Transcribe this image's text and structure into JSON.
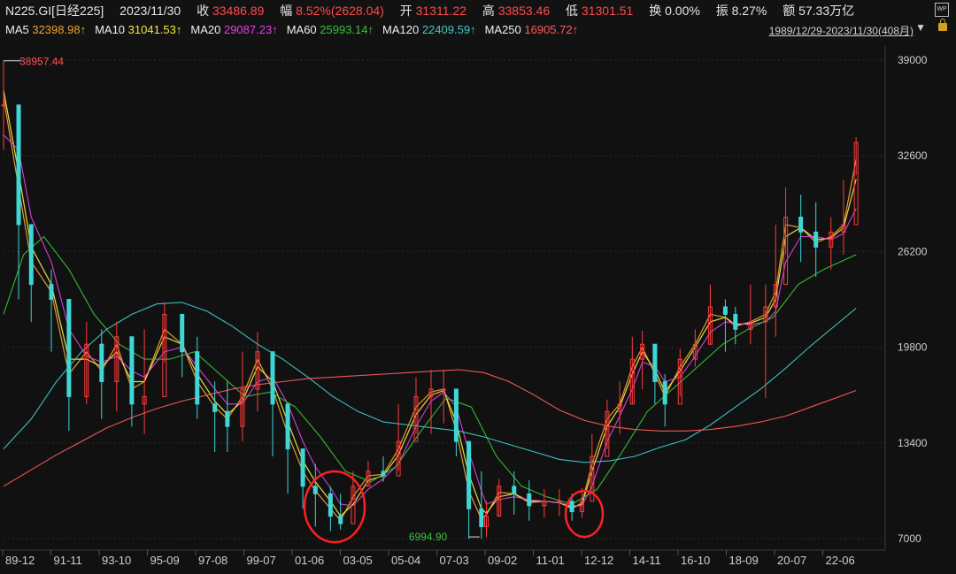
{
  "header": {
    "symbol": "N225.GI[日经225]",
    "date": "2023/11/30",
    "close_label": "收",
    "close_value": "33486.89",
    "change_label": "幅",
    "change_value": "8.52%(2628.04)",
    "open_label": "开",
    "open_value": "31311.22",
    "high_label": "高",
    "high_value": "33853.46",
    "low_label": "低",
    "low_value": "31301.51",
    "turnover_label": "换",
    "turnover_value": "0.00%",
    "amplitude_label": "振",
    "amplitude_value": "8.27%",
    "amount_label": "额",
    "amount_value": "57.33万亿",
    "range": "1989/12/29-2023/11/30(408月)",
    "wp_label": "WP",
    "ma": [
      {
        "name": "MA5",
        "value": "32398.98↑",
        "color": "#f0f0f0",
        "value_color": "#f0a030"
      },
      {
        "name": "MA10",
        "value": "31041.53↑",
        "color": "#f0f0f0",
        "value_color": "#f5e642"
      },
      {
        "name": "MA20",
        "value": "29087.23↑",
        "color": "#f0f0f0",
        "value_color": "#e040e0"
      },
      {
        "name": "MA60",
        "value": "25993.14↑",
        "color": "#f0f0f0",
        "value_color": "#36c236"
      },
      {
        "name": "MA120",
        "value": "22409.59↑",
        "color": "#f0f0f0",
        "value_color": "#40c8c8"
      },
      {
        "name": "MA250",
        "value": "16905.72↑",
        "color": "#f0f0f0",
        "value_color": "#ff5a5a"
      }
    ]
  },
  "chart_data": {
    "type": "line",
    "x_tick_labels": [
      "89-12",
      "91-11",
      "93-10",
      "95-09",
      "97-08",
      "99-07",
      "01-06",
      "03-05",
      "05-04",
      "07-03",
      "09-02",
      "11-01",
      "12-12",
      "14-11",
      "16-10",
      "18-09",
      "20-07",
      "22-06"
    ],
    "y_ticks": [
      7000,
      13400,
      19800,
      26200,
      32600,
      39000
    ],
    "ylim": [
      7000,
      39000
    ],
    "annotations": {
      "high": "38957.44",
      "low": "6994.90"
    },
    "candles": {
      "x": [
        1989.9,
        1990.5,
        1991.0,
        1991.8,
        1992.5,
        1993.2,
        1993.8,
        1994.4,
        1995.0,
        1995.5,
        1996.3,
        1997.0,
        1997.6,
        1998.3,
        1998.8,
        1999.4,
        2000.0,
        2000.6,
        2001.2,
        2001.8,
        2002.3,
        2002.9,
        2003.3,
        2003.8,
        2004.4,
        2005.0,
        2005.6,
        2006.3,
        2006.9,
        2007.4,
        2007.9,
        2008.4,
        2008.9,
        2009.1,
        2009.6,
        2010.2,
        2010.8,
        2011.4,
        2012.0,
        2012.5,
        2012.9,
        2013.3,
        2013.9,
        2014.4,
        2014.9,
        2015.3,
        2015.8,
        2016.2,
        2016.8,
        2017.4,
        2018.0,
        2018.6,
        2019.0,
        2019.6,
        2020.2,
        2020.6,
        2021.0,
        2021.6,
        2022.2,
        2022.8,
        2023.3,
        2023.8
      ],
      "close": [
        36000,
        28000,
        24000,
        23000,
        16500,
        20000,
        17500,
        20500,
        16000,
        16500,
        22000,
        19500,
        16000,
        15500,
        14500,
        17000,
        19500,
        16000,
        13000,
        10500,
        10000,
        8500,
        8000,
        10500,
        11500,
        11200,
        13500,
        16500,
        17000,
        17000,
        13500,
        9000,
        7800,
        8500,
        10500,
        10000,
        9200,
        9500,
        9500,
        8800,
        9500,
        12500,
        15500,
        16000,
        19000,
        20000,
        17500,
        16000,
        19000,
        20000,
        22500,
        22000,
        21000,
        21500,
        22500,
        24000,
        28500,
        27500,
        26500,
        27500,
        28000,
        33486.89
      ],
      "high": [
        38957.44,
        33000,
        27500,
        25000,
        22000,
        21500,
        21000,
        21500,
        20000,
        21000,
        22800,
        21000,
        20500,
        17500,
        17500,
        19500,
        20800,
        18500,
        15000,
        12500,
        12000,
        10500,
        10000,
        11500,
        12200,
        12500,
        16000,
        17800,
        18300,
        18300,
        16500,
        13500,
        11500,
        9500,
        11000,
        11500,
        10900,
        10300,
        10300,
        10000,
        10400,
        14000,
        16300,
        17500,
        20500,
        20900,
        19500,
        18000,
        19700,
        21000,
        24000,
        23000,
        22500,
        24000,
        24000,
        28000,
        30500,
        30000,
        29500,
        28500,
        31000,
        33853.46
      ],
      "low": [
        33000,
        23000,
        21500,
        19500,
        14200,
        16000,
        15000,
        15500,
        14500,
        14000,
        18800,
        17800,
        15000,
        12800,
        12800,
        13500,
        15500,
        12500,
        10000,
        9000,
        7800,
        7500,
        7607,
        9500,
        10500,
        10800,
        11500,
        14000,
        14000,
        14700,
        12500,
        7000,
        6994.9,
        7100,
        8500,
        8600,
        8200,
        8400,
        8500,
        8200,
        8400,
        10000,
        13000,
        14000,
        16000,
        17000,
        16000,
        14500,
        16500,
        18500,
        20000,
        19500,
        20000,
        20000,
        16400,
        20500,
        26000,
        25500,
        24500,
        25000,
        26000,
        31301.51
      ]
    },
    "series": [
      {
        "name": "MA5",
        "color": "#f0a030",
        "x": [
          1989.9,
          1990.5,
          1991.0,
          1991.8,
          1992.5,
          1993.2,
          1993.8,
          1994.4,
          1995.0,
          1995.5,
          1996.3,
          1997.0,
          1997.6,
          1998.3,
          1998.8,
          1999.4,
          2000.0,
          2000.6,
          2001.2,
          2001.8,
          2002.3,
          2002.9,
          2003.3,
          2003.8,
          2004.4,
          2005.0,
          2005.6,
          2006.3,
          2006.9,
          2007.4,
          2007.9,
          2008.4,
          2008.9,
          2009.1,
          2009.6,
          2010.2,
          2010.8,
          2011.4,
          2012.0,
          2012.5,
          2012.9,
          2013.3,
          2013.9,
          2014.4,
          2014.9,
          2015.3,
          2015.8,
          2016.2,
          2016.8,
          2017.4,
          2018.0,
          2018.6,
          2019.0,
          2019.6,
          2020.2,
          2020.6,
          2021.0,
          2021.6,
          2022.2,
          2022.8,
          2023.3,
          2023.8
        ],
        "y": [
          36500,
          30500,
          25500,
          23500,
          18000,
          19500,
          18200,
          20000,
          17000,
          17500,
          21000,
          20000,
          17500,
          15800,
          15000,
          16500,
          19000,
          17000,
          14000,
          11500,
          10200,
          9000,
          8200,
          9800,
          11200,
          11300,
          13000,
          15800,
          16800,
          17000,
          14200,
          10200,
          8300,
          8600,
          10100,
          10000,
          9400,
          9500,
          9400,
          9000,
          9400,
          12000,
          15000,
          16000,
          18500,
          19800,
          18000,
          16500,
          18500,
          20000,
          22000,
          21800,
          21200,
          21500,
          22000,
          23500,
          28000,
          27800,
          26800,
          27200,
          28000,
          32398.98
        ]
      },
      {
        "name": "MA10",
        "color": "#f5e642",
        "x": [
          1989.9,
          1990.5,
          1991.0,
          1991.8,
          1992.5,
          1993.2,
          1993.8,
          1994.4,
          1995.0,
          1995.5,
          1996.3,
          1997.0,
          1997.6,
          1998.3,
          1998.8,
          1999.4,
          2000.0,
          2000.6,
          2001.2,
          2001.8,
          2002.3,
          2002.9,
          2003.3,
          2003.8,
          2004.4,
          2005.0,
          2005.6,
          2006.3,
          2006.9,
          2007.4,
          2007.9,
          2008.4,
          2008.9,
          2009.1,
          2009.6,
          2010.2,
          2010.8,
          2011.4,
          2012.0,
          2012.5,
          2012.9,
          2013.3,
          2013.9,
          2014.4,
          2014.9,
          2015.3,
          2015.8,
          2016.2,
          2016.8,
          2017.4,
          2018.0,
          2018.6,
          2019.0,
          2019.6,
          2020.2,
          2020.6,
          2021.0,
          2021.6,
          2022.2,
          2022.8,
          2023.3,
          2023.8
        ],
        "y": [
          37000,
          31500,
          26500,
          24000,
          19000,
          19000,
          18500,
          19500,
          17500,
          17500,
          20500,
          20000,
          18000,
          16200,
          15300,
          16200,
          18500,
          17500,
          14800,
          12200,
          10800,
          9500,
          8500,
          9300,
          10900,
          11200,
          12600,
          15300,
          16600,
          16900,
          14800,
          11300,
          9000,
          8700,
          9800,
          10000,
          9500,
          9500,
          9400,
          9100,
          9300,
          11500,
          14500,
          15800,
          18000,
          19500,
          18300,
          16800,
          18200,
          19800,
          21500,
          21800,
          21300,
          21400,
          21800,
          23000,
          27200,
          27800,
          27000,
          27100,
          27800,
          31041.53
        ]
      },
      {
        "name": "MA20",
        "color": "#e040e0",
        "x": [
          1989.9,
          1990.5,
          1991.0,
          1991.8,
          1992.5,
          1993.2,
          1993.8,
          1994.4,
          1995.0,
          1995.5,
          1996.3,
          1997.0,
          1997.6,
          1998.3,
          1998.8,
          1999.4,
          2000.0,
          2000.6,
          2001.2,
          2001.8,
          2002.3,
          2002.9,
          2003.3,
          2003.8,
          2004.4,
          2005.0,
          2005.6,
          2006.3,
          2006.9,
          2007.4,
          2007.9,
          2008.4,
          2008.9,
          2009.1,
          2009.6,
          2010.2,
          2010.8,
          2011.4,
          2012.0,
          2012.5,
          2012.9,
          2013.3,
          2013.9,
          2014.4,
          2014.9,
          2015.3,
          2015.8,
          2016.2,
          2016.8,
          2017.4,
          2018.0,
          2018.6,
          2019.0,
          2019.6,
          2020.2,
          2020.6,
          2021.0,
          2021.6,
          2022.2,
          2022.8,
          2023.3,
          2023.8
        ],
        "y": [
          34000,
          33000,
          28500,
          25500,
          21000,
          19200,
          18800,
          19200,
          18200,
          17800,
          19500,
          19800,
          18500,
          17000,
          16000,
          16000,
          17500,
          17800,
          16000,
          13500,
          11800,
          10400,
          9300,
          9200,
          10300,
          11000,
          12000,
          14500,
          16200,
          16800,
          15800,
          12800,
          10200,
          9300,
          9600,
          9800,
          9600,
          9500,
          9400,
          9200,
          9200,
          10500,
          13500,
          15200,
          17000,
          18800,
          18500,
          17500,
          17800,
          19200,
          20800,
          21500,
          21400,
          21300,
          21500,
          22200,
          25500,
          27200,
          27200,
          27000,
          27400,
          29087.23
        ]
      },
      {
        "name": "MA60",
        "color": "#36c236",
        "x": [
          1989.9,
          1990.7,
          1991.5,
          1992.5,
          1993.5,
          1994.5,
          1995.5,
          1996.5,
          1997.5,
          1998.5,
          1999.5,
          2000.5,
          2001.5,
          2002.5,
          2003.5,
          2004.5,
          2005.5,
          2006.5,
          2007.5,
          2008.5,
          2009.5,
          2010.5,
          2011.5,
          2012.5,
          2013.5,
          2014.5,
          2015.5,
          2016.5,
          2017.5,
          2018.5,
          2019.5,
          2020.5,
          2021.5,
          2022.5,
          2023.8
        ],
        "y": [
          22000,
          26000,
          27200,
          25000,
          22000,
          20000,
          19000,
          19000,
          19500,
          18000,
          16500,
          16800,
          15800,
          13800,
          11500,
          10800,
          11800,
          14200,
          16400,
          15800,
          12500,
          10500,
          9800,
          9300,
          10300,
          12800,
          15500,
          17000,
          18500,
          20000,
          21000,
          21800,
          24000,
          25000,
          25993.14
        ]
      },
      {
        "name": "MA120",
        "color": "#40c8c8",
        "x": [
          1989.9,
          1991.0,
          1992.0,
          1993.0,
          1994.0,
          1995.0,
          1996.0,
          1997.0,
          1998.0,
          1999.0,
          2000.0,
          2001.0,
          2002.0,
          2003.0,
          2004.0,
          2005.0,
          2006.0,
          2007.0,
          2008.0,
          2009.0,
          2010.0,
          2011.0,
          2012.0,
          2013.0,
          2014.0,
          2015.0,
          2016.0,
          2017.0,
          2018.0,
          2019.0,
          2020.0,
          2021.0,
          2022.0,
          2023.8
        ],
        "y": [
          13000,
          15000,
          17500,
          19500,
          21000,
          22000,
          22700,
          22800,
          22200,
          21200,
          20000,
          19000,
          17800,
          16500,
          15500,
          14800,
          14600,
          14400,
          14200,
          13800,
          13300,
          12800,
          12300,
          12100,
          12200,
          12500,
          13100,
          13600,
          14600,
          15800,
          17000,
          18400,
          19900,
          22409.59
        ]
      },
      {
        "name": "MA250",
        "color": "#ff5a5a",
        "x": [
          1989.9,
          1991.0,
          1992.0,
          1993.0,
          1994.0,
          1995.0,
          1996.0,
          1997.0,
          1998.0,
          1999.0,
          2000.0,
          2001.0,
          2002.0,
          2003.0,
          2004.0,
          2005.0,
          2006.0,
          2007.0,
          2008.0,
          2009.0,
          2010.0,
          2011.0,
          2012.0,
          2013.0,
          2014.0,
          2015.0,
          2016.0,
          2017.0,
          2018.0,
          2019.0,
          2020.0,
          2021.0,
          2022.0,
          2023.8
        ],
        "y": [
          10500,
          11600,
          12600,
          13500,
          14400,
          15100,
          15700,
          16200,
          16600,
          17000,
          17300,
          17500,
          17700,
          17800,
          17900,
          18000,
          18100,
          18200,
          18300,
          18100,
          17500,
          16600,
          15600,
          14900,
          14500,
          14300,
          14200,
          14200,
          14300,
          14500,
          14800,
          15200,
          15800,
          16905.72
        ]
      }
    ]
  }
}
